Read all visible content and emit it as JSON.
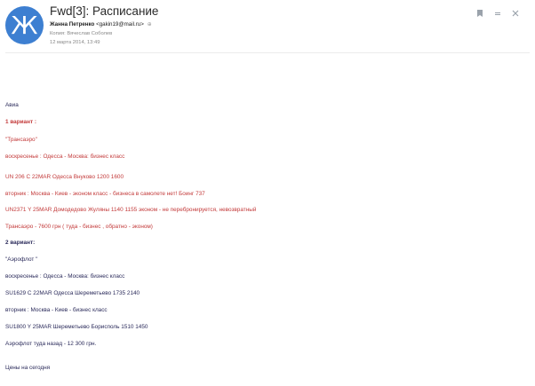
{
  "header": {
    "avatar_letter": "Ж",
    "subject": "Fwd[3]: Расписание",
    "sender_name": "Жанна Петренко",
    "sender_email": "<gakin19@mail.ru>",
    "copy_line": "Копия: Вячеслав Соболев",
    "date": "12 марта 2014, 13:49"
  },
  "actions": [
    "bookmark-icon",
    "more-icon",
    "close-icon"
  ],
  "colors": {
    "avatar": "#3d7fd1",
    "red_text": "#c33a3a",
    "dark_text": "#2a2a5a"
  },
  "body": [
    {
      "text": "Авиа",
      "style": "dark"
    },
    {
      "text": "1 вариант :",
      "style": "red bold"
    },
    {
      "text": "\"Трансаэро\"",
      "style": "red"
    },
    {
      "text": "воскресенье : Одесса - Москва: бизнес класс",
      "style": "red"
    },
    {
      "text": "UN 206 C 22MAR Одесса Внуково                1200 1600",
      "style": "red"
    },
    {
      "text": "вторник : Москва - Киев - эконом класс - бизнеса в самолете нет!  Боинг 737",
      "style": "red"
    },
    {
      "text": "UN2371 Y 25MAR Домодедово Жуляны      1140 1155       эконом - не перебронируется, невозвратный",
      "style": "red"
    },
    {
      "text": "Трансаэро -   7600 грн ( туда - бизнес , обратно - эконом)",
      "style": "red"
    },
    {
      "text": "2 вариант:",
      "style": "dark bold"
    },
    {
      "text": "\"Аэрофлот \"",
      "style": "dark"
    },
    {
      "text": "воскресенье : Одесса - Москва: бизнес класс",
      "style": "dark"
    },
    {
      "text": " SU1629 C 22MAR Одесса Шереметьево  1735 2140",
      "style": "dark"
    },
    {
      "text": "вторник : Москва - Киев - бизнес класс",
      "style": "dark"
    },
    {
      "text": " SU1800 Y 25MAR    Шереметьево Борисполь 1510 1450",
      "style": "dark"
    },
    {
      "text": "Аэрофлот туда назад -  12 300  грн.",
      "style": "dark"
    },
    {
      "text": "Цены на сегодня",
      "style": "dark"
    }
  ]
}
